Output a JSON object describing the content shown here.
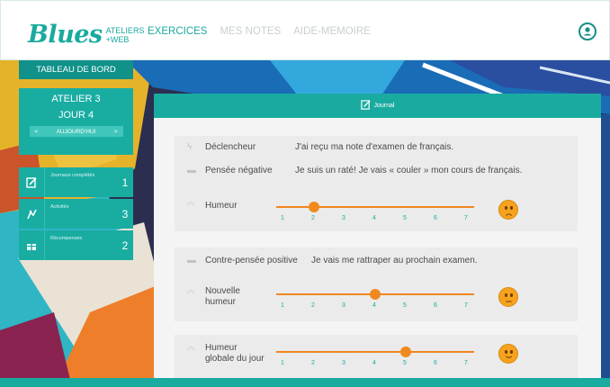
{
  "header": {
    "logo": "Blues",
    "logo_sub1": "ATELIERS",
    "logo_sub2": "+WEB",
    "nav": [
      "EXERCICES",
      "MES NOTES",
      "AIDE-MEMOIRE"
    ],
    "user_icon": "user-circle-icon"
  },
  "sidebar": {
    "header": "TABLEAU DE BORD",
    "atelier": "ATELIER 3",
    "jour": "JOUR 4",
    "today_label": "AUJOURD'HUI",
    "prev_arrow": "<",
    "next_arrow": ">",
    "items": [
      {
        "label": "Journaux complétés",
        "count": "1",
        "icon": "journal-icon"
      },
      {
        "label": "Activités",
        "count": "3",
        "icon": "activity-icon"
      },
      {
        "label": "Récompenses",
        "count": "2",
        "icon": "gift-icon"
      }
    ]
  },
  "journal": {
    "title": "Journal",
    "declencheur_label": "Déclencheur",
    "declencheur_value": "J'ai reçu ma note d'examen de français.",
    "pensee_label": "Pensée négative",
    "pensee_value": "Je suis un raté! Je vais « couler » mon cours de français.",
    "humeur_label": "Humeur",
    "humeur_value": 2,
    "contre_label": "Contre-pensée positive",
    "contre_value": "Je vais me rattraper au prochain examen.",
    "nouvelle_label_1": "Nouvelle",
    "nouvelle_label_2": "humeur",
    "nouvelle_value": 4,
    "globale_label_1": "Humeur",
    "globale_label_2": "globale du jour",
    "globale_value": 5,
    "scale": [
      "1",
      "2",
      "3",
      "4",
      "5",
      "6",
      "7"
    ]
  },
  "colors": {
    "brand": "#1aaa9f",
    "slider": "#f08620",
    "face": "#f6a21f"
  }
}
